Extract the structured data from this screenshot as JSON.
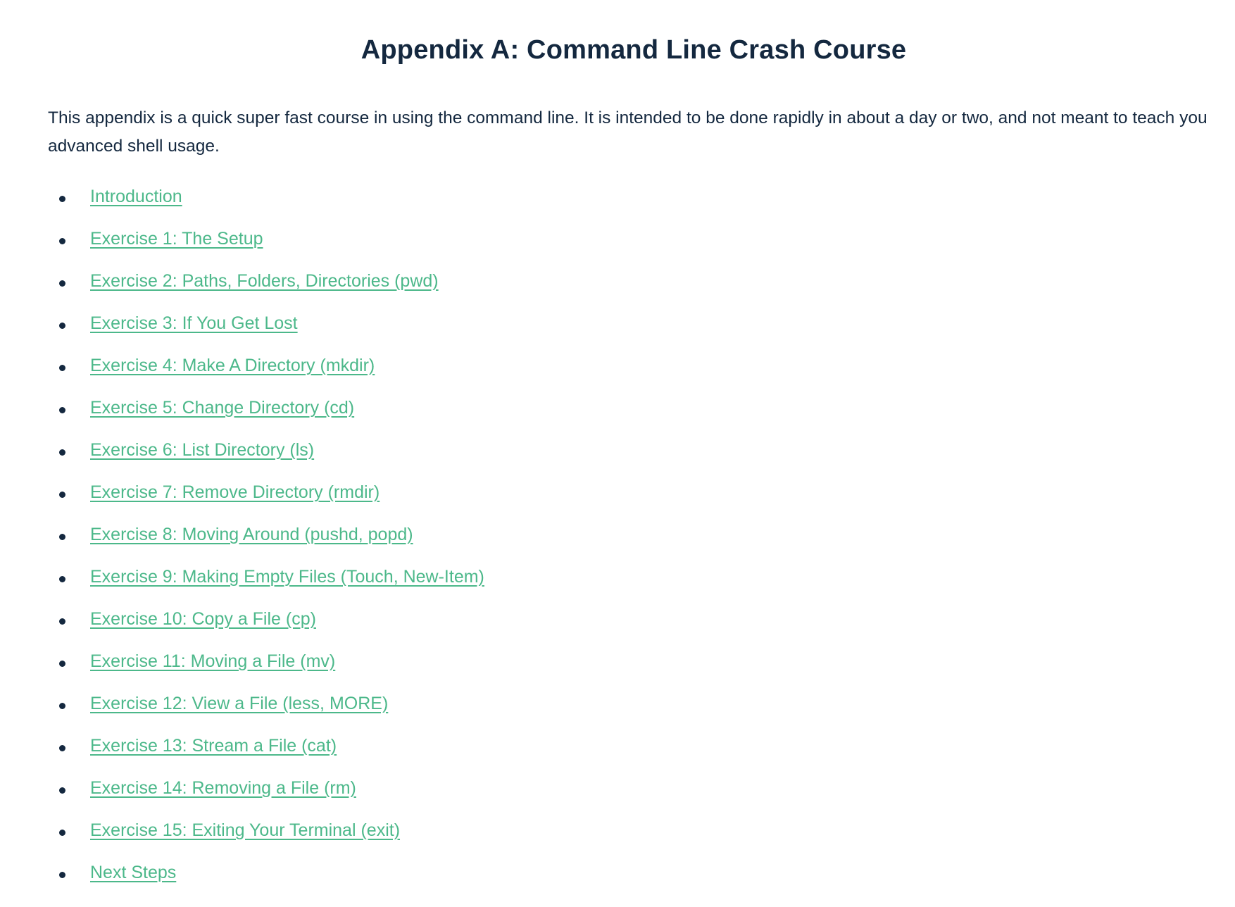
{
  "document": {
    "title": "Appendix A: Command Line Crash Course",
    "intro": "This appendix is a quick super fast course in using the command line. It is intended to be done rapidly in about a day or two, and not meant to teach you advanced shell usage."
  },
  "toc": {
    "link_color": "#4cb88a",
    "items": [
      {
        "label": "Introduction"
      },
      {
        "label": "Exercise 1: The Setup"
      },
      {
        "label": "Exercise 2: Paths, Folders, Directories (pwd)"
      },
      {
        "label": "Exercise 3: If You Get Lost"
      },
      {
        "label": "Exercise 4: Make A Directory (mkdir)"
      },
      {
        "label": "Exercise 5: Change Directory (cd)"
      },
      {
        "label": "Exercise 6: List Directory (ls)"
      },
      {
        "label": "Exercise 7: Remove Directory (rmdir)"
      },
      {
        "label": "Exercise 8: Moving Around (pushd, popd)"
      },
      {
        "label": "Exercise 9: Making Empty Files (Touch, New-Item)"
      },
      {
        "label": "Exercise 10: Copy a File (cp)"
      },
      {
        "label": "Exercise 11: Moving a File (mv)"
      },
      {
        "label": "Exercise 12: View a File (less, MORE)"
      },
      {
        "label": "Exercise 13: Stream a File (cat)"
      },
      {
        "label": "Exercise 14: Removing a File (rm)"
      },
      {
        "label": "Exercise 15: Exiting Your Terminal (exit)"
      },
      {
        "label": "Next Steps"
      }
    ]
  }
}
